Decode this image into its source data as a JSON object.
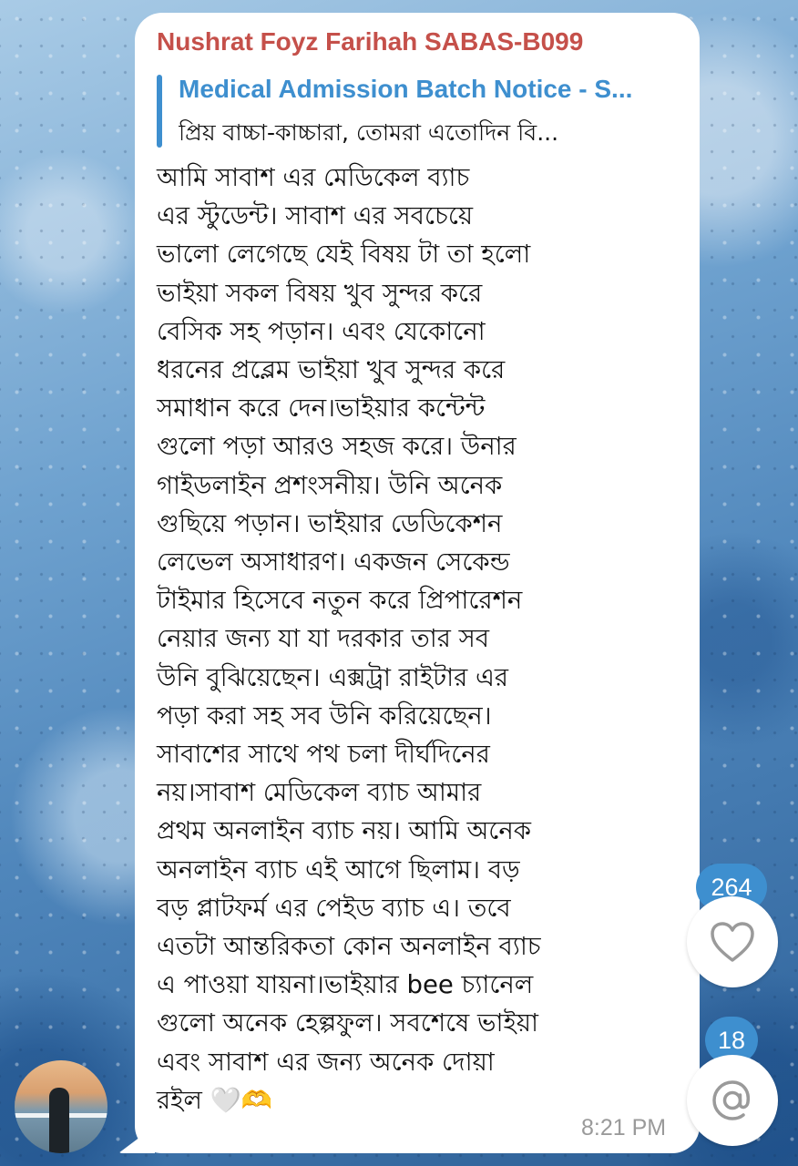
{
  "message": {
    "sender_name": "Nushrat Foyz Farihah SABAS-B099",
    "reply": {
      "title": "Medical Admission Batch Notice - S...",
      "preview": "প্রিয় বাচ্চা-কাচ্চারা,  তোমরা এতোদিন বি..."
    },
    "body": "আমি সাবাশ এর মেডিকেল ব্যাচ\nএর স্টুডেন্ট। সাবাশ এর সবচেয়ে\nভালো লেগেছে যেই বিষয় টা তা হলো\nভাইয়া সকল বিষয় খুব সুন্দর করে\nবেসিক সহ পড়ান। এবং যেকোনো\nধরনের প্রব্লেম ভাইয়া খুব সুন্দর করে\nসমাধান করে দেন।ভাইয়ার কন্টেন্ট\nগুলো পড়া আরও সহজ করে। উনার\nগাইডলাইন প্রশংসনীয়। উনি অনেক\nগুছিয়ে পড়ান। ভাইয়ার ডেডিকেশন\nলেভেল অসাধারণ। একজন সেকেন্ড\nটাইমার হিসেবে নতুন করে প্রিপারেশন\nনেয়ার জন্য যা যা দরকার তার সব\nউনি বুঝিয়েছেন।  এক্সট্রা রাইটার এর\nপড়া করা সহ সব উনি করিয়েছেন।\nসাবাশের সাথে পথ চলা দীর্ঘদিনের\nনয়।সাবাশ মেডিকেল ব্যাচ আমার\nপ্রথম অনলাইন ব্যাচ নয়। আমি অনেক\nঅনলাইন ব্যাচ এই আগে ছিলাম। বড়\nবড় প্লাটফর্ম এর পেইড ব্যাচ এ। তবে\nএতটা আন্তরিকতা কোন অনলাইন ব্যাচ\nএ পাওয়া যায়না।ভাইয়ার bee চ্যানেল\nগুলো অনেক হেল্পফুল। সবশেষে ভাইয়া\nএবং সাবাশ এর জন্য অনেক দোয়া\nরইল 🤍🫶",
    "time": "8:21 PM"
  },
  "side_actions": {
    "like_count": "264",
    "mention_count": "18",
    "like_icon": "heart-outline-icon",
    "mention_icon": "at-sign-icon"
  },
  "colors": {
    "sender": "#c5504a",
    "accent": "#3e8fcf",
    "time": "#9a9a9a",
    "bubble": "#ffffff"
  }
}
